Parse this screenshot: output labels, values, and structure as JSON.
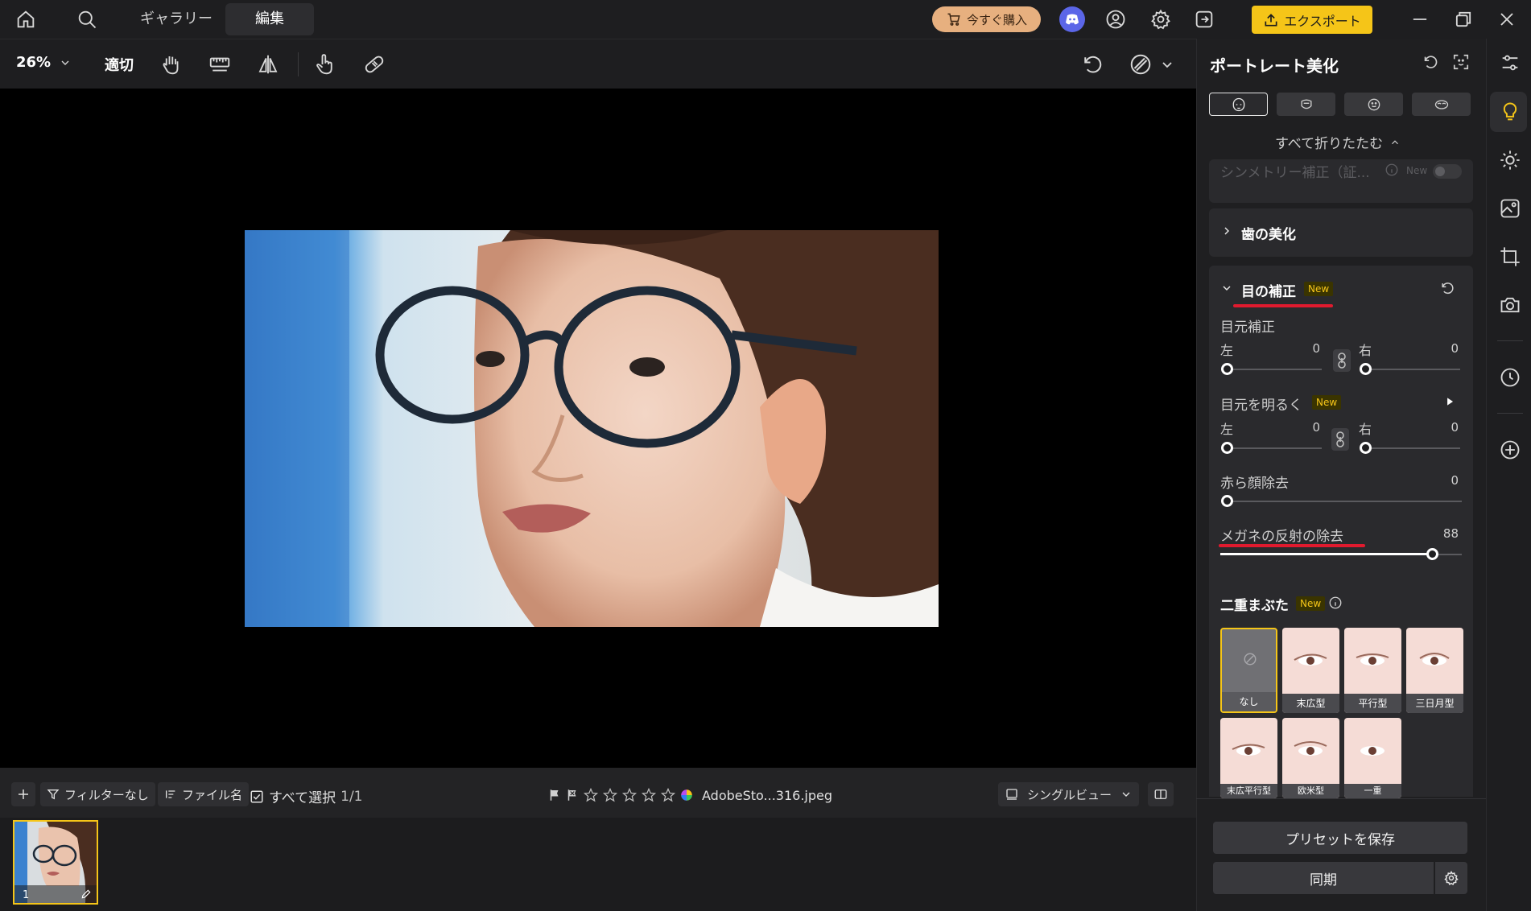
{
  "topbar": {
    "tabs": [
      {
        "label": "ギャラリー"
      },
      {
        "label": "編集"
      }
    ],
    "buy_label": "今すぐ購入",
    "export_label": "エクスポート",
    "icons": [
      "home-icon",
      "search-icon",
      "cart-icon",
      "discord-icon",
      "user-icon",
      "settings-icon",
      "sign-out-icon",
      "upload-icon",
      "minimize-icon",
      "restore-icon",
      "close-icon"
    ]
  },
  "toolbar": {
    "zoom": "26%",
    "fit_label": "適切",
    "icons": [
      "hand-icon",
      "ruler-icon",
      "flip-icon",
      "pointer-hand-icon",
      "bandage-icon",
      "undo-icon",
      "overlay-icon"
    ]
  },
  "filmbar": {
    "filter_label": "フィルターなし",
    "sort_label": "ファイル名",
    "select_all_label": "すべて選択",
    "selection_count": "1/1",
    "rating_stars": 5,
    "filename": "AdobeSto...316.jpeg",
    "view_label": "シングルビュー"
  },
  "filmstrip": {
    "items": [
      {
        "index": "1"
      }
    ]
  },
  "panel": {
    "title": "ポートレート美化",
    "collapse_all": "すべて折りたたむ",
    "faded_row": "シンメトリー補正（証...",
    "new_badge": "New",
    "teeth_section": "歯の美化",
    "eye_section": {
      "title": "目の補正",
      "eye_correction": {
        "label": "目元補正",
        "left_label": "左",
        "right_label": "右",
        "left_value": 0,
        "right_value": 0
      },
      "eye_brighten": {
        "label": "目元を明るく",
        "left_label": "左",
        "right_label": "右",
        "left_value": 0,
        "right_value": 0
      },
      "red_eye": {
        "label": "赤ら顔除去",
        "value": 0
      },
      "glasses_glare": {
        "label": "メガネの反射の除去",
        "value": 88
      },
      "double_eyelid": {
        "label": "二重まぶた",
        "presets": [
          "なし",
          "末広型",
          "平行型",
          "三日月型",
          "末広平行型",
          "欧米型",
          "一重"
        ]
      }
    },
    "save_preset": "プリセットを保存",
    "sync": "同期"
  },
  "rail": {
    "icons": [
      "sliders-icon",
      "bulb-icon",
      "sun-icon",
      "image-adjust-icon",
      "crop-icon",
      "camera-icon",
      "history-icon",
      "add-icon"
    ]
  },
  "colors": {
    "accent": "#f5c518",
    "buy": "#e7b07f",
    "discord": "#5b66e8",
    "annotation_red": "#e01a2e"
  }
}
